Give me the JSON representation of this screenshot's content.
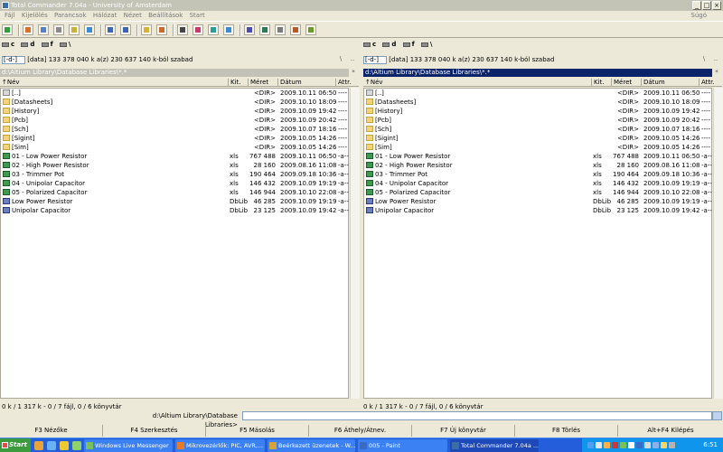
{
  "window": {
    "title": "Total Commander 7.04a - University of Amsterdam",
    "minimize": "_",
    "maximize": "□",
    "close": "×"
  },
  "menu": [
    "Fájl",
    "Kijelölés",
    "Parancsok",
    "Hálózat",
    "Nézet",
    "Beállítások",
    "Start"
  ],
  "menu_help": "Súgó",
  "toolbar_icons": [
    "refresh-icon",
    "brief-view-icon",
    "full-view-icon",
    "tree-icon",
    "thumbnail-icon",
    "invert-selection-icon",
    "back-icon",
    "forward-icon",
    "pack-icon",
    "unpack-icon",
    "find-icon",
    "multi-rename-icon",
    "sync-dirs-icon",
    "ftp-icon",
    "notepad-icon",
    "network-icon",
    "view-icon",
    "edit-icon",
    "notes-icon"
  ],
  "left": {
    "drives": [
      "c",
      "d",
      "f",
      "\\"
    ],
    "drive_select": "[-d-]",
    "volume_info": "[data]  133 378 040 k  a(z) 230 637 140 k-ból szabad",
    "path": "d:\\Altium Library\\Database Libraries\\*.*",
    "corner_left": "\\",
    "corner_right": "..",
    "status": "0 k / 1 317 k - 0 / 7 fájl, 0 / 6 könyvtár"
  },
  "right": {
    "drives": [
      "c",
      "d",
      "f",
      "\\"
    ],
    "drive_select": "[-d-]",
    "volume_info": "[data]  133 378 040 k  a(z) 230 637 140 k-ból szabad",
    "path": "d:\\Altium Library\\Database Libraries\\*.*",
    "corner_left": "\\",
    "corner_right": "..",
    "status": "0 k / 1 317 k - 0 / 7 fájl, 0 / 6 könyvtár"
  },
  "columns": {
    "name": "↑Név",
    "ext": "Kit.",
    "size": "Méret",
    "date": "Dátum",
    "attr": "Attr."
  },
  "files": [
    {
      "icon": "up",
      "name": "[..]",
      "ext": "",
      "size": "<DIR>",
      "date": "2009.10.11 06:50",
      "attr": "----"
    },
    {
      "icon": "folder",
      "name": "[Datasheets]",
      "ext": "",
      "size": "<DIR>",
      "date": "2009.10.10 18:09",
      "attr": "----"
    },
    {
      "icon": "folder",
      "name": "[History]",
      "ext": "",
      "size": "<DIR>",
      "date": "2009.10.09 19:42",
      "attr": "----"
    },
    {
      "icon": "folder",
      "name": "[Pcb]",
      "ext": "",
      "size": "<DIR>",
      "date": "2009.10.09 20:42",
      "attr": "----"
    },
    {
      "icon": "folder",
      "name": "[Sch]",
      "ext": "",
      "size": "<DIR>",
      "date": "2009.10.07 18:16",
      "attr": "----"
    },
    {
      "icon": "folder",
      "name": "[Sigint]",
      "ext": "",
      "size": "<DIR>",
      "date": "2009.10.05 14:26",
      "attr": "----"
    },
    {
      "icon": "folder",
      "name": "[Sim]",
      "ext": "",
      "size": "<DIR>",
      "date": "2009.10.05 14:26",
      "attr": "----"
    },
    {
      "icon": "xls",
      "name": "01 - Low Power Resistor",
      "ext": "xls",
      "size": "767 488",
      "date": "2009.10.11 06:50",
      "attr": "-a--"
    },
    {
      "icon": "xls",
      "name": "02 - High Power Resistor",
      "ext": "xls",
      "size": "28 160",
      "date": "2009.08.16 11:08",
      "attr": "-a--"
    },
    {
      "icon": "xls",
      "name": "03 - Trimmer Pot",
      "ext": "xls",
      "size": "190 464",
      "date": "2009.09.18 10:36",
      "attr": "-a--"
    },
    {
      "icon": "xls",
      "name": "04 - Unipolar Capacitor",
      "ext": "xls",
      "size": "146 432",
      "date": "2009.10.09 19:19",
      "attr": "-a--"
    },
    {
      "icon": "xls",
      "name": "05 - Polarized Capacitor",
      "ext": "xls",
      "size": "146 944",
      "date": "2009.10.10 22:08",
      "attr": "-a--"
    },
    {
      "icon": "dblib",
      "name": "Low Power Resistor",
      "ext": "DbLib",
      "size": "46 285",
      "date": "2009.10.09 19:19",
      "attr": "-a--"
    },
    {
      "icon": "dblib",
      "name": "Unipolar Capacitor",
      "ext": "DbLib",
      "size": "23 125",
      "date": "2009.10.09 19:42",
      "attr": "-a--"
    }
  ],
  "cmdline": {
    "path": "d:\\Altium Library\\Database Libraries>",
    "value": ""
  },
  "fkeys": [
    "F3 Nézőke",
    "F4 Szerkesztés",
    "F5 Másolás",
    "F6 Áthely/Átnev.",
    "F7 Új könyvtár",
    "F8 Törlés",
    "Alt+F4 Kilépés"
  ],
  "taskbar": {
    "start": "Start",
    "tasks": [
      {
        "label": "Windows Live Messenger",
        "active": false
      },
      {
        "label": "Mikrovezérlők: PIC, AVR,...",
        "active": false
      },
      {
        "label": "Beérkezett üzenetek - W...",
        "active": false
      },
      {
        "label": "005 - Paint",
        "active": false
      },
      {
        "label": "Total Commander 7.04a ...",
        "active": true
      }
    ],
    "clock": "6:51"
  },
  "colors": {
    "active_path": "#0a246a",
    "inactive_path": "#c4c2b6",
    "taskbar": "#245edb",
    "start": "#3c9b3c"
  }
}
